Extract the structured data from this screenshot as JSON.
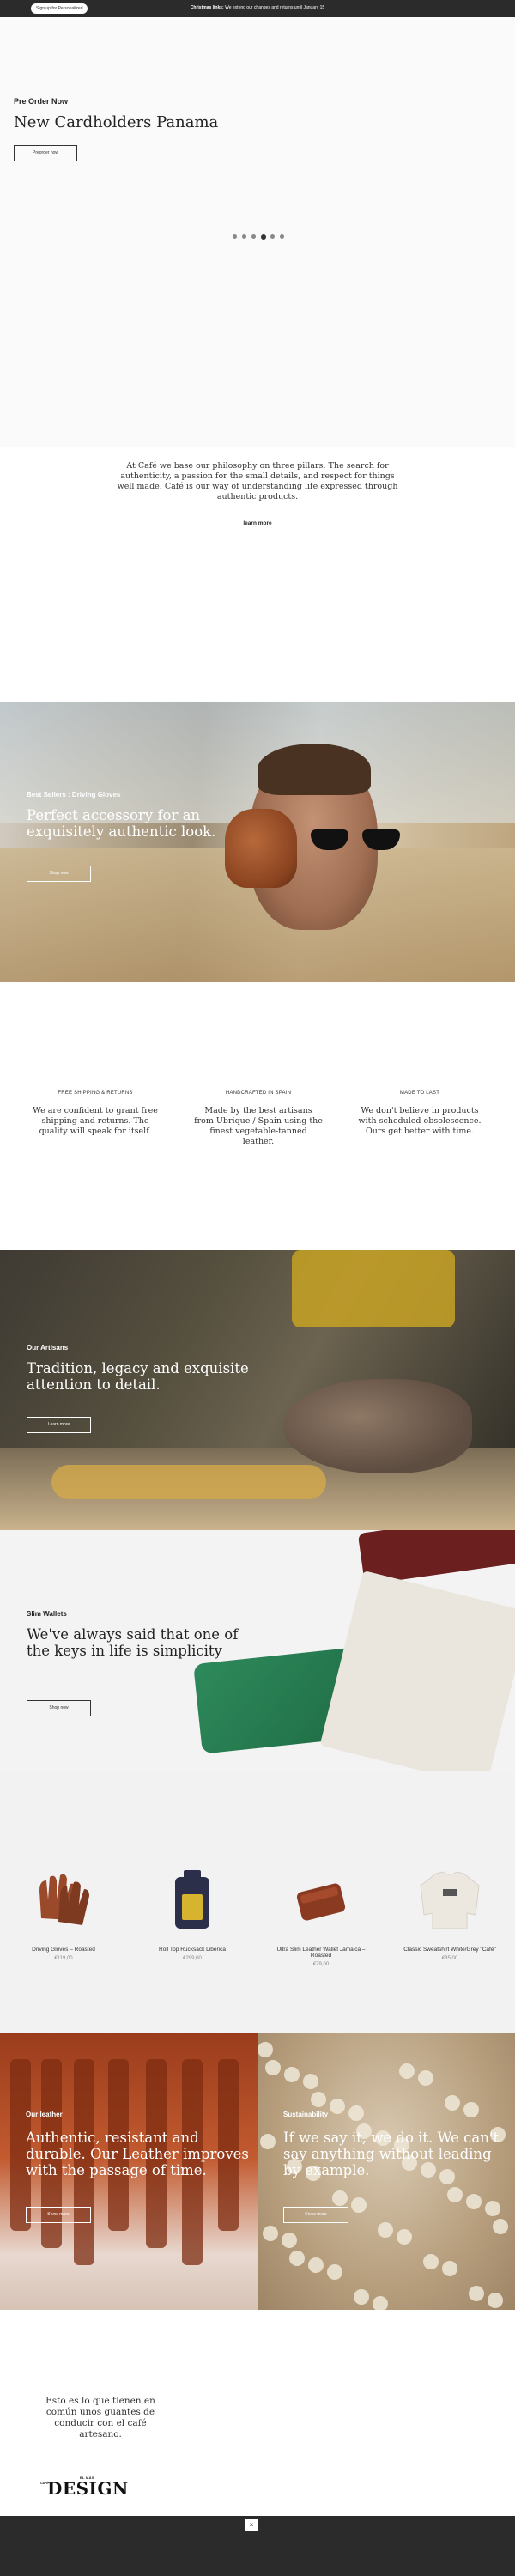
{
  "topbar": {
    "pill": "Sign up for Personalized",
    "msg_bold": "Christmas links:",
    "msg_rest": "We extend our changes and returns until January 15"
  },
  "hero": {
    "kicker": "Pre Order Now",
    "title": "New Cardholders Panama",
    "button": "Preorder now",
    "slide_count": 6,
    "active_slide": 4
  },
  "philosophy": {
    "text": "At Café we base our philosophy on three pillars: The search for authenticity, a passion for the small details, and respect for things well made. Café is our way of understanding life expressed through authentic products.",
    "link": "learn more"
  },
  "driving": {
    "kicker": "Best Sellers : Driving Gloves",
    "headline": "Perfect accessory for an exquisitely authentic look.",
    "button": "Shop now"
  },
  "features": [
    {
      "title": "FREE SHIPPING & RETURNS",
      "body": "We are confident to grant free shipping and returns. The quality will speak for itself."
    },
    {
      "title": "HANDCRAFTED IN SPAIN",
      "body": "Made by the best artisans from Ubrique / Spain using the finest vegetable-tanned leather."
    },
    {
      "title": "MADE TO LAST",
      "body": "We don't believe in products with scheduled obsolescence. Ours get better with time."
    }
  ],
  "artisans": {
    "kicker": "Our Artisans",
    "headline": "Tradition, legacy and exquisite attention to detail.",
    "button": "Learn more"
  },
  "wallets": {
    "kicker": "Slim Wallets",
    "headline": "We've always said that one of the keys in life is simplicity",
    "button": "Shop now"
  },
  "products": [
    {
      "name": "Driving Gloves – Roasted",
      "price": "€119,00"
    },
    {
      "name": "Roll Top Rucksack Libérica",
      "price": "€299,00"
    },
    {
      "name": "Ultra Slim Leather Wallet Jamaica – Roasted",
      "price": "€79,00"
    },
    {
      "name": "Classic Sweatshirt White/Grey \"Café\"",
      "price": "€85,00"
    }
  ],
  "leather": {
    "kicker": "Our leather",
    "headline": "Authentic, resistant and durable. Our Leather improves with the passage of time.",
    "button": "Know more"
  },
  "sustain": {
    "kicker": "Sustainability",
    "headline": "If we say it, we do it. We can't say anything without leading by example.",
    "button": "Know more"
  },
  "quote": "Esto es lo que tienen en común unos guantes de conducir con el café artesano.",
  "logo": {
    "small": "EL MÁS",
    "side": "CAFÉ",
    "big": "DESIGN"
  },
  "footer": {
    "close": "×",
    "tiny": "·"
  }
}
